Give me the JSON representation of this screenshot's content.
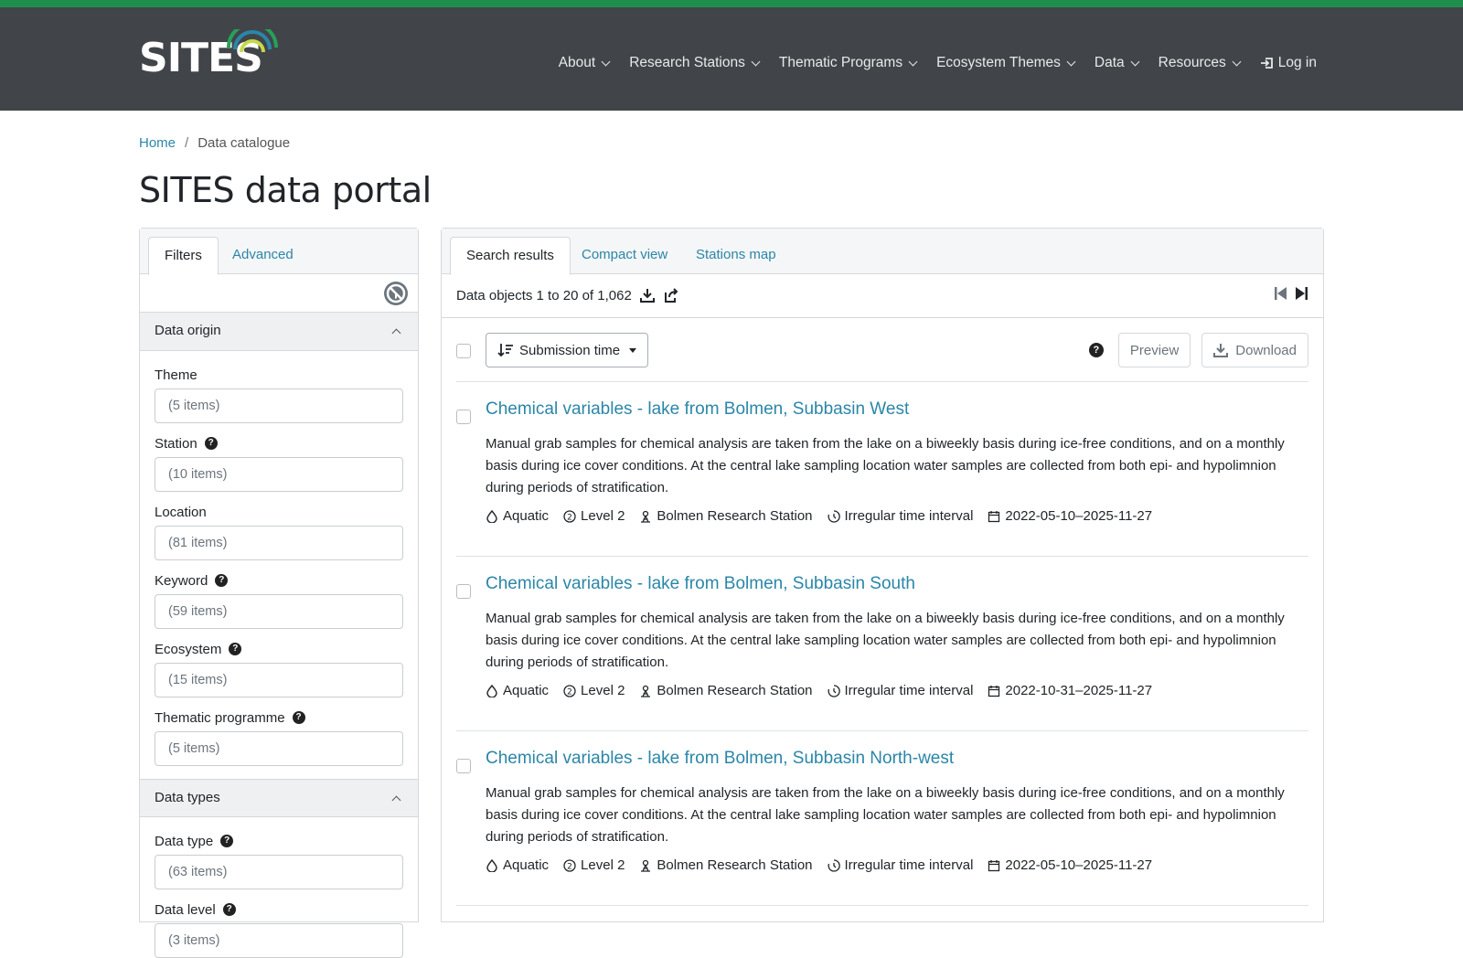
{
  "brand": {
    "logo_text": "SITES",
    "accent_stripe": "#1f8e4c",
    "navbar_bg": "#414549",
    "link_color": "#2b86a8"
  },
  "nav": {
    "items": [
      {
        "label": "About"
      },
      {
        "label": "Research Stations"
      },
      {
        "label": "Thematic Programs"
      },
      {
        "label": "Ecosystem Themes"
      },
      {
        "label": "Data"
      },
      {
        "label": "Resources"
      }
    ],
    "login": "Log in"
  },
  "breadcrumb": {
    "home": "Home",
    "separator": "/",
    "current": "Data catalogue"
  },
  "page_title": "SITES data portal",
  "left_panel": {
    "tabs": [
      "Filters",
      "Advanced"
    ],
    "sections": {
      "origin": "Data origin",
      "types": "Data types"
    },
    "filters": [
      {
        "label": "Theme",
        "value": "(5 items)",
        "help": false
      },
      {
        "label": "Station",
        "value": "(10 items)",
        "help": true
      },
      {
        "label": "Location",
        "value": "(81 items)",
        "help": false
      },
      {
        "label": "Keyword",
        "value": "(59 items)",
        "help": true
      },
      {
        "label": "Ecosystem",
        "value": "(15 items)",
        "help": true
      },
      {
        "label": "Thematic programme",
        "value": "(5 items)",
        "help": true
      }
    ],
    "type_filters": [
      {
        "label": "Data type",
        "value": "(63 items)",
        "help": true
      },
      {
        "label": "Data level",
        "value": "(3 items)",
        "help": true
      }
    ],
    "help_glyph": "?"
  },
  "right_panel": {
    "tabs": [
      "Search results",
      "Compact view",
      "Stations map"
    ],
    "count_text": "Data objects 1 to 20 of 1,062",
    "sort_label": "Submission time",
    "preview_label": "Preview",
    "download_label": "Download",
    "help_glyph": "?",
    "results": [
      {
        "title": "Chemical variables - lake from Bolmen, Subbasin West",
        "description": "Manual grab samples for chemical analysis are taken from the lake on a biweekly basis during ice-free conditions, and on a monthly basis during ice cover conditions. At the central lake sampling location water samples are collected from both epi- and hypolimnion during periods of stratification.",
        "theme": "Aquatic",
        "level": "Level 2",
        "station": "Bolmen Research Station",
        "interval": "Irregular time interval",
        "dates": "2022-05-10–2025-11-27"
      },
      {
        "title": "Chemical variables - lake from Bolmen, Subbasin South",
        "description": "Manual grab samples for chemical analysis are taken from the lake on a biweekly basis during ice-free conditions, and on a monthly basis during ice cover conditions. At the central lake sampling location water samples are collected from both epi- and hypolimnion during periods of stratification.",
        "theme": "Aquatic",
        "level": "Level 2",
        "station": "Bolmen Research Station",
        "interval": "Irregular time interval",
        "dates": "2022-10-31–2025-11-27"
      },
      {
        "title": "Chemical variables - lake from Bolmen, Subbasin North-west",
        "description": "Manual grab samples for chemical analysis are taken from the lake on a biweekly basis during ice-free conditions, and on a monthly basis during ice cover conditions. At the central lake sampling location water samples are collected from both epi- and hypolimnion during periods of stratification.",
        "theme": "Aquatic",
        "level": "Level 2",
        "station": "Bolmen Research Station",
        "interval": "Irregular time interval",
        "dates": "2022-05-10–2025-11-27"
      }
    ]
  }
}
